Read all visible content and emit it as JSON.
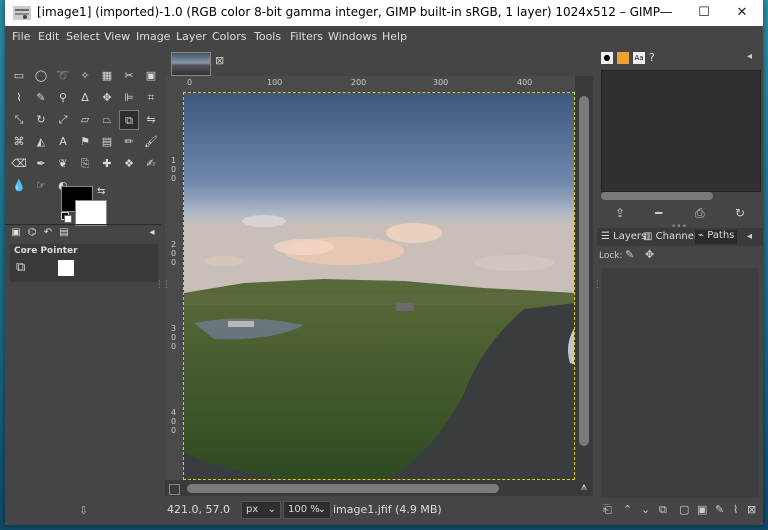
{
  "window": {
    "title": "[image1] (imported)-1.0 (RGB color 8-bit gamma integer, GIMP built-in sRGB, 1 layer) 1024x512 – GIMP",
    "controls": {
      "minimize": "—",
      "maximize": "☐",
      "close": "✕"
    }
  },
  "menubar": [
    "File",
    "Edit",
    "Select",
    "View",
    "Image",
    "Layer",
    "Colors",
    "Tools",
    "Filters",
    "Windows",
    "Help"
  ],
  "toolbox": {
    "tools": [
      "rect-select",
      "ellipse-select",
      "free-select",
      "fuzzy-select",
      "by-color-select",
      "scissors-select",
      "foreground-select",
      "color-picker",
      "zoom",
      "measure",
      "move",
      "align",
      "crop",
      "rotate",
      "scale",
      "shear",
      "perspective",
      "unified-transform",
      "flip",
      "cage",
      "warp",
      "text",
      "bucket-fill",
      "gradient",
      "pencil",
      "paintbrush",
      "eraser",
      "airbrush",
      "ink",
      "mypaint",
      "clone",
      "heal",
      "perspective-clone",
      "blur",
      "smudge",
      "dodge-burn"
    ],
    "colors": {
      "foreground": "#000000",
      "background": "#ffffff"
    }
  },
  "tool_options": {
    "label": "Core Pointer"
  },
  "image_tab": {
    "close": "⊠"
  },
  "rulers": {
    "h_ticks": [
      "0",
      "100",
      "200",
      "300",
      "400"
    ],
    "v_ticks": [
      "1 0 0",
      "2 0 0",
      "3 0 0",
      "4 0 0"
    ]
  },
  "statusbar": {
    "coords": "421.0, 57.0",
    "unit": "px",
    "zoom": "100 %",
    "file": "image1.jfif (4.9 MB)"
  },
  "right_panel": {
    "tabs": [
      "Layers",
      "Channels",
      "Paths"
    ],
    "lock_label": "Lock:"
  },
  "colors": {
    "window_bg": "#454545",
    "selection_border": "#e0d000"
  }
}
